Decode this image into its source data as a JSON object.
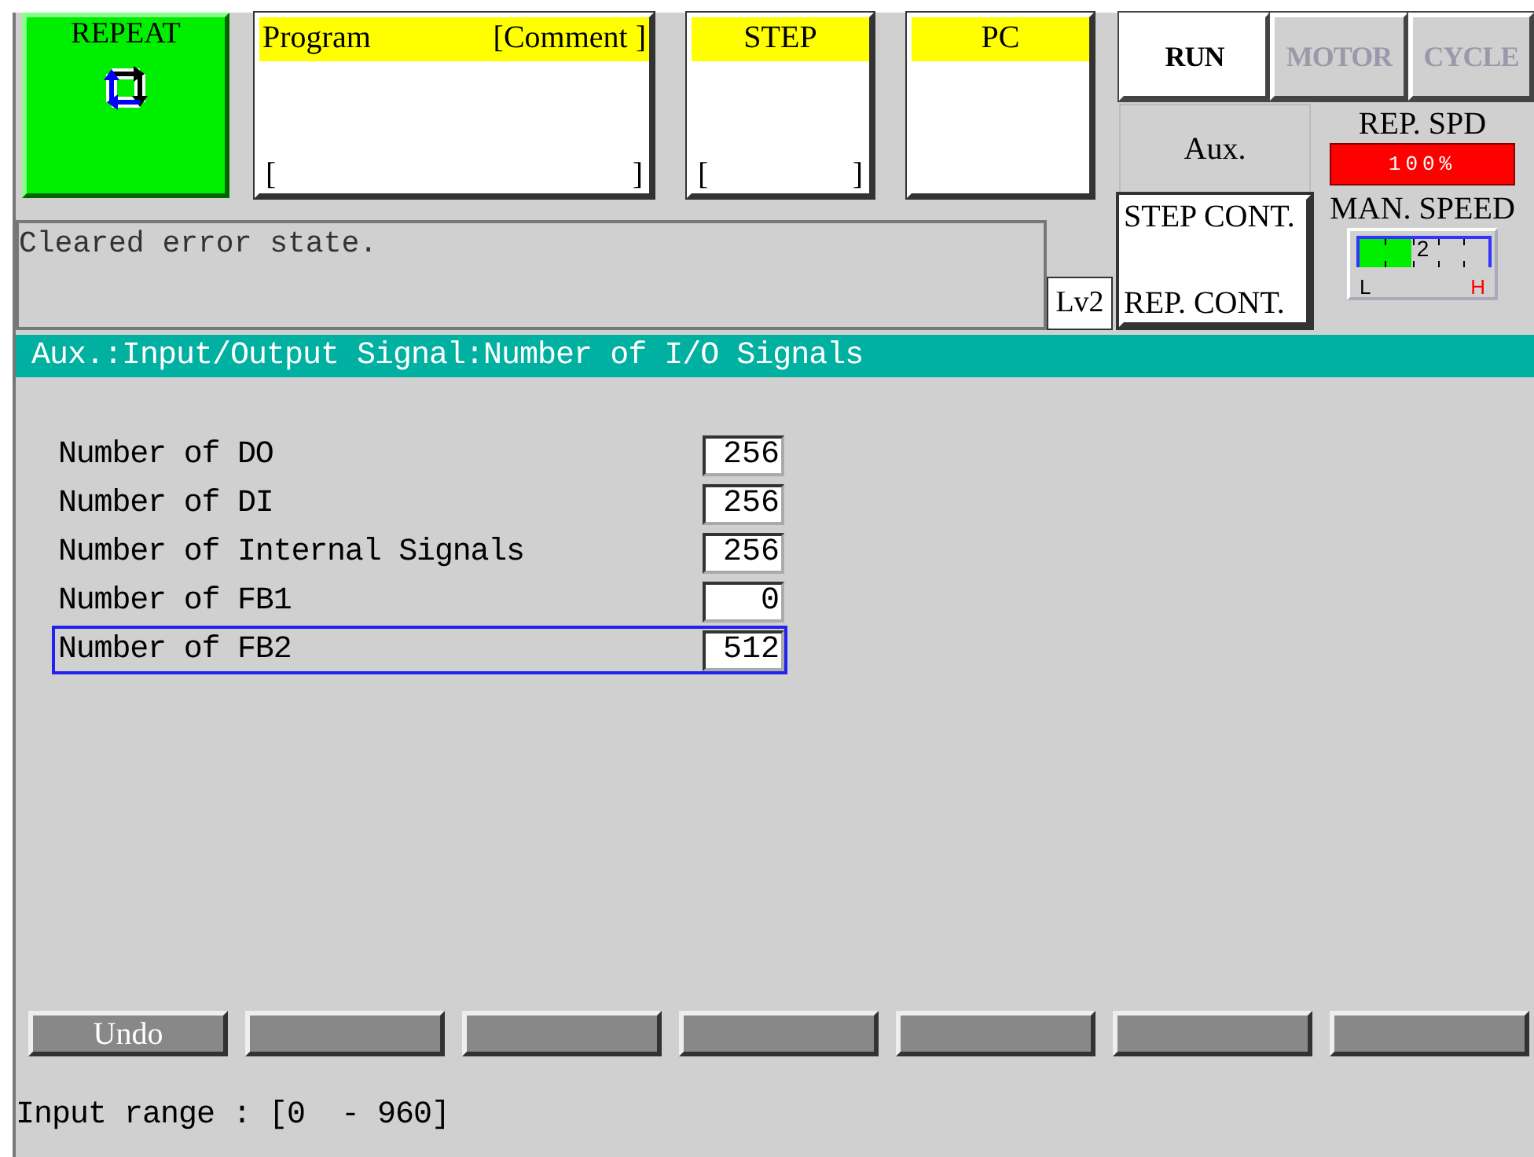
{
  "mode_tile": {
    "label": "REPEAT"
  },
  "program_tile": {
    "title": "Program",
    "comment": "[Comment ]",
    "open_bracket": "[",
    "close_bracket": "]"
  },
  "step_tile": {
    "title": "STEP",
    "open_bracket": "[",
    "close_bracket": "]"
  },
  "pc_tile": {
    "title": "PC"
  },
  "status_buttons": [
    {
      "label": "RUN",
      "on": true
    },
    {
      "label": "MOTOR",
      "on": false
    },
    {
      "label": "CYCLE",
      "on": false
    }
  ],
  "aux_button": {
    "label": "Aux."
  },
  "rep_speed": {
    "label": "REP. SPD",
    "reading": "100%"
  },
  "cont_box": {
    "lines": [
      "STEP CONT.",
      "REP. CONT."
    ]
  },
  "man_speed": {
    "label": "MAN. SPEED",
    "level": 0.4,
    "reading": "2",
    "low": "L",
    "high": "H"
  },
  "message": "Cleared error state.",
  "level_badge": "Lv2",
  "title": "Aux.:Input/Output Signal:Number of I/O Signals",
  "rows": [
    {
      "label": "Number of DO",
      "value": "256",
      "selected": false
    },
    {
      "label": "Number of DI",
      "value": "256",
      "selected": false
    },
    {
      "label": "Number of Internal Signals",
      "value": "256",
      "selected": false
    },
    {
      "label": "Number of FB1",
      "value": "0",
      "selected": false
    },
    {
      "label": "Number of FB2",
      "value": "512",
      "selected": true
    }
  ],
  "softkeys": [
    {
      "kind": "labeled",
      "label": "Undo"
    },
    {
      "kind": "blank"
    },
    {
      "kind": "blank"
    },
    {
      "kind": "blank"
    },
    {
      "kind": "blank"
    },
    {
      "kind": "blank"
    },
    {
      "kind": "blank"
    }
  ],
  "status_bar": "Input range : [0  - 960]"
}
